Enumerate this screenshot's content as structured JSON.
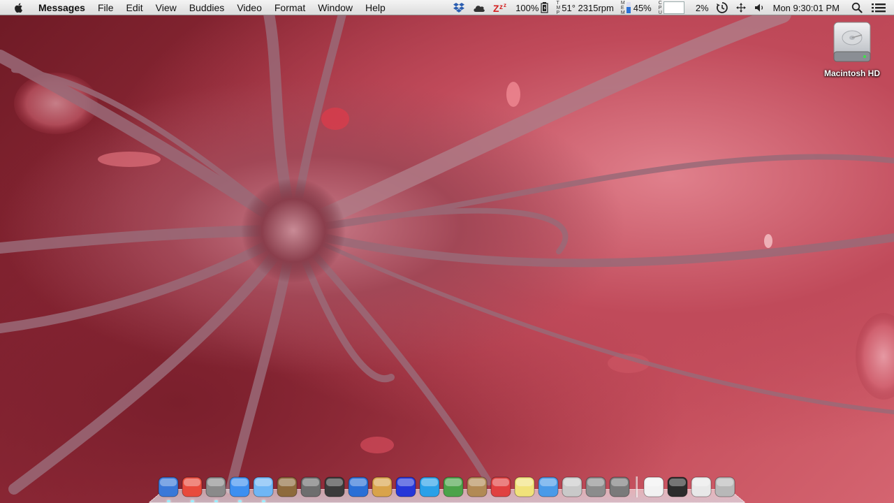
{
  "menubar": {
    "app_name": "Messages",
    "menus": [
      "File",
      "Edit",
      "View",
      "Buddies",
      "Video",
      "Format",
      "Window",
      "Help"
    ],
    "status": {
      "battery_percent": "100%",
      "temp_fan": "51° 2315rpm",
      "temp_label": [
        "T",
        "M",
        "P"
      ],
      "memory_label": [
        "M",
        "E",
        "M"
      ],
      "memory_percent": "45%",
      "cpu_label": [
        "C",
        "P",
        "U"
      ],
      "cpu_percent": "2%",
      "cpu_level": 0.02,
      "clock": "Mon 9:30:01 PM"
    }
  },
  "desktop_icons": [
    {
      "label": "Macintosh HD",
      "icon": "hard-drive-icon"
    }
  ],
  "dock": {
    "apps": [
      {
        "name": "finder-icon",
        "color": "#3a78d8"
      },
      {
        "name": "chrome-icon",
        "color": "#e84a3c"
      },
      {
        "name": "mail-stamp-icon",
        "color": "#8a8a8a"
      },
      {
        "name": "itunes-icon",
        "color": "#3d8ff0"
      },
      {
        "name": "messages-icon",
        "color": "#6fb6f5"
      },
      {
        "name": "iphoto-icon",
        "color": "#8e6a3c"
      },
      {
        "name": "launchpad-icon",
        "color": "#6e6e6e"
      },
      {
        "name": "photo-booth-icon",
        "color": "#3b3b3b"
      },
      {
        "name": "word-icon",
        "color": "#2a6fd6"
      },
      {
        "name": "sandwich-icon",
        "color": "#d9a34a"
      },
      {
        "name": "smiley-icon",
        "color": "#2536d8"
      },
      {
        "name": "three-icon",
        "color": "#2aa0e8"
      },
      {
        "name": "utorrent-icon",
        "color": "#4ca34a"
      },
      {
        "name": "address-book-icon",
        "color": "#b28a55"
      },
      {
        "name": "calendar-icon",
        "color": "#e04040"
      },
      {
        "name": "stickies-icon",
        "color": "#f1e27a"
      },
      {
        "name": "app-store-icon",
        "color": "#4a9ae8"
      },
      {
        "name": "preview-icon",
        "color": "#c9c9c9"
      },
      {
        "name": "utility-icon",
        "color": "#8c8c8c"
      },
      {
        "name": "system-preferences-icon",
        "color": "#7a7a7a"
      }
    ],
    "docs": [
      {
        "name": "document-icon",
        "color": "#f2f2f2"
      },
      {
        "name": "screen-sharing-icon",
        "color": "#2c2c2c"
      },
      {
        "name": "browser-window-icon",
        "color": "#e8e8e8"
      },
      {
        "name": "trash-icon",
        "color": "#b8b8b8"
      }
    ]
  }
}
